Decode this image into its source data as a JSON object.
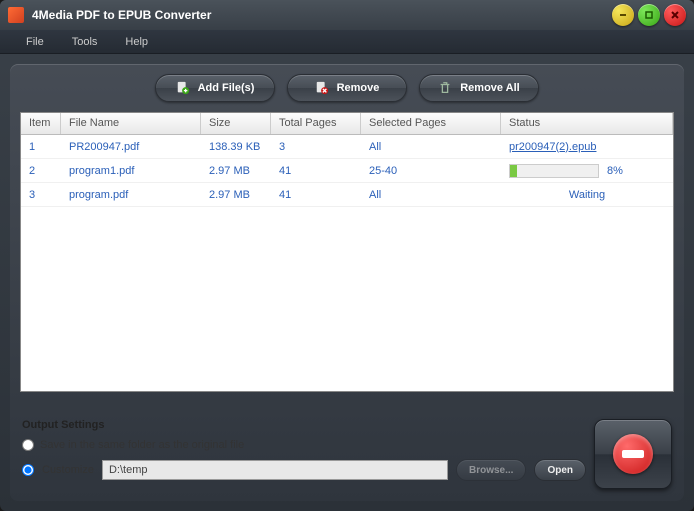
{
  "app": {
    "title": "4Media PDF to EPUB Converter"
  },
  "menu": {
    "file": "File",
    "tools": "Tools",
    "help": "Help"
  },
  "toolbar": {
    "add": "Add File(s)",
    "remove": "Remove",
    "remove_all": "Remove All"
  },
  "columns": {
    "item": "Item",
    "name": "File Name",
    "size": "Size",
    "pages": "Total Pages",
    "selected": "Selected Pages",
    "status": "Status"
  },
  "rows": [
    {
      "item": "1",
      "name": "PR200947.pdf",
      "size": "138.39 KB",
      "pages": "3",
      "selected": "All",
      "status_type": "link",
      "status_text": "pr200947(2).epub"
    },
    {
      "item": "2",
      "name": "program1.pdf",
      "size": "2.97 MB",
      "pages": "41",
      "selected": "25-40",
      "status_type": "progress",
      "status_text": "8%",
      "progress_pct": 8
    },
    {
      "item": "3",
      "name": "program.pdf",
      "size": "2.97 MB",
      "pages": "41",
      "selected": "All",
      "status_type": "waiting",
      "status_text": "Waiting"
    }
  ],
  "output": {
    "title": "Output Settings",
    "same_folder_label": "Save in the same folder as the original file",
    "customize_label": "Customize",
    "path": "D:\\temp",
    "browse": "Browse...",
    "open": "Open",
    "selected": "customize"
  }
}
